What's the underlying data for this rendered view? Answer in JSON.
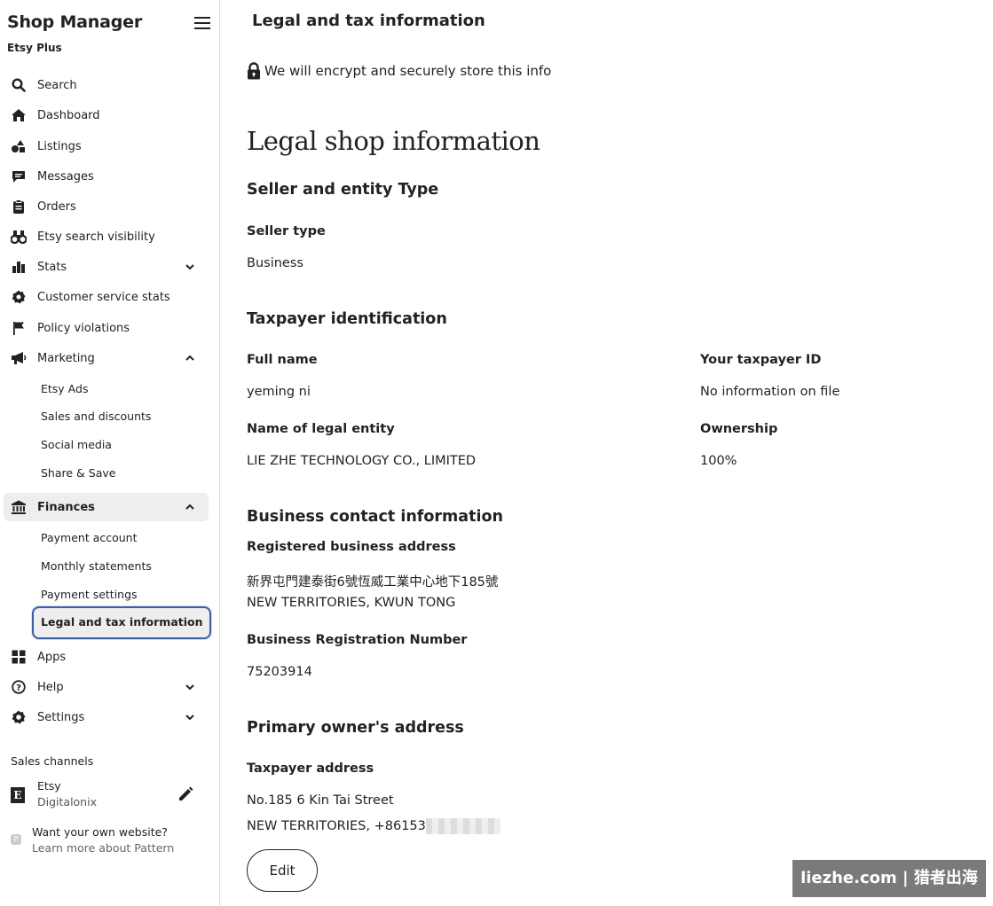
{
  "sidebar": {
    "title": "Shop Manager",
    "subtitle": "Etsy Plus",
    "items": {
      "search": {
        "label": "Search",
        "icon": "search-icon"
      },
      "dashboard": {
        "label": "Dashboard",
        "icon": "home-icon"
      },
      "listings": {
        "label": "Listings",
        "icon": "shapes-icon"
      },
      "messages": {
        "label": "Messages",
        "icon": "chat-icon"
      },
      "orders": {
        "label": "Orders",
        "icon": "clipboard-icon"
      },
      "search_visibility": {
        "label": "Etsy search visibility",
        "icon": "binoculars-icon"
      },
      "stats": {
        "label": "Stats",
        "icon": "bar-chart-icon"
      },
      "customer_service": {
        "label": "Customer service stats",
        "icon": "gear-badge-icon"
      },
      "policy": {
        "label": "Policy violations",
        "icon": "flag-icon"
      },
      "marketing": {
        "label": "Marketing",
        "icon": "megaphone-icon"
      },
      "finances": {
        "label": "Finances",
        "icon": "bank-icon"
      },
      "apps": {
        "label": "Apps",
        "icon": "grid-icon"
      },
      "help": {
        "label": "Help",
        "icon": "question-icon"
      },
      "settings": {
        "label": "Settings",
        "icon": "gear-icon"
      }
    },
    "marketing_sub": [
      "Etsy Ads",
      "Sales and discounts",
      "Social media",
      "Share & Save"
    ],
    "finances_sub": [
      "Payment account",
      "Monthly statements",
      "Payment settings",
      "Legal and tax information"
    ],
    "sales_channels_label": "Sales channels",
    "channel": {
      "name": "Etsy",
      "shop": "Digitalonix"
    },
    "promo": {
      "line1": "Want your own website?",
      "line2": "Learn more about Pattern"
    }
  },
  "main": {
    "page_title": "Legal and tax information",
    "secure_note": "We will encrypt and securely store this info",
    "legal_heading": "Legal shop information",
    "seller_section": "Seller and entity Type",
    "seller_type_label": "Seller type",
    "seller_type_value": "Business",
    "taxpayer_section": "Taxpayer identification",
    "full_name_label": "Full name",
    "full_name_value": "yeming ni",
    "taxpayer_id_label": "Your taxpayer ID",
    "taxpayer_id_value": "No information on file",
    "legal_entity_label": "Name of legal entity",
    "legal_entity_value": "LIE ZHE TECHNOLOGY CO., LIMITED",
    "ownership_label": "Ownership",
    "ownership_value": "100%",
    "contact_section": "Business contact information",
    "reg_address_label": "Registered business address",
    "reg_address_line1": "新界屯門建泰街6號恆威工業中心地下185號",
    "reg_address_line2": "NEW TERRITORIES, KWUN TONG",
    "reg_number_label": "Business Registration Number",
    "reg_number_value": "75203914",
    "owner_section": "Primary owner's address",
    "taxpayer_address_label": "Taxpayer address",
    "taxpayer_address_line1": "No.185 6 Kin Tai Street",
    "taxpayer_address_line2": "NEW TERRITORIES, +86153",
    "edit_label": "Edit"
  },
  "watermark": "liezhe.com | 猎者出海"
}
